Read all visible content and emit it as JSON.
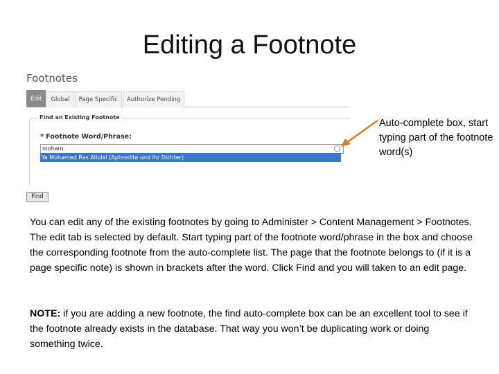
{
  "slide": {
    "title": "Editing a Footnote",
    "callout": "Auto-complete box, start typing part of the footnote word(s)",
    "body": "You can edit any of the existing footnotes by going to Administer > Content Management > Footnotes. The edit tab is selected by default. Start typing part of the footnote word/phrase in the box and choose the corresponding footnote from the auto-complete list. The page that the footnote belongs to (if it is a page specific note) is shown in brackets after the word. Click Find and you will taken to an edit page.",
    "note_label": "NOTE:",
    "note_text": " if you are adding a new footnote, the find auto-complete box can be an excellent tool to see if the footnote already exists in the database. That way you won’t be duplicating work or doing something twice."
  },
  "screenshot": {
    "panel_title": "Footnotes",
    "tabs": [
      {
        "label": "Edit",
        "active": true
      },
      {
        "label": "Global",
        "active": false
      },
      {
        "label": "Page Specific",
        "active": false
      },
      {
        "label": "Authorize Pending",
        "active": false
      }
    ],
    "fieldset_legend": "Find an Existing Footnote",
    "required_mark": "*",
    "field_label": "Footnote Word/Phrase:",
    "input_value": "moham",
    "suggestion": "Ya Mohamed Ras Allulal (Aphrodite und ihr Dichter)",
    "find_button": "Find"
  },
  "colors": {
    "selected_suggestion": "#3877c9",
    "arrow": "#e07b22",
    "active_tab": "#8a8a8a",
    "required": "#cc0000"
  }
}
